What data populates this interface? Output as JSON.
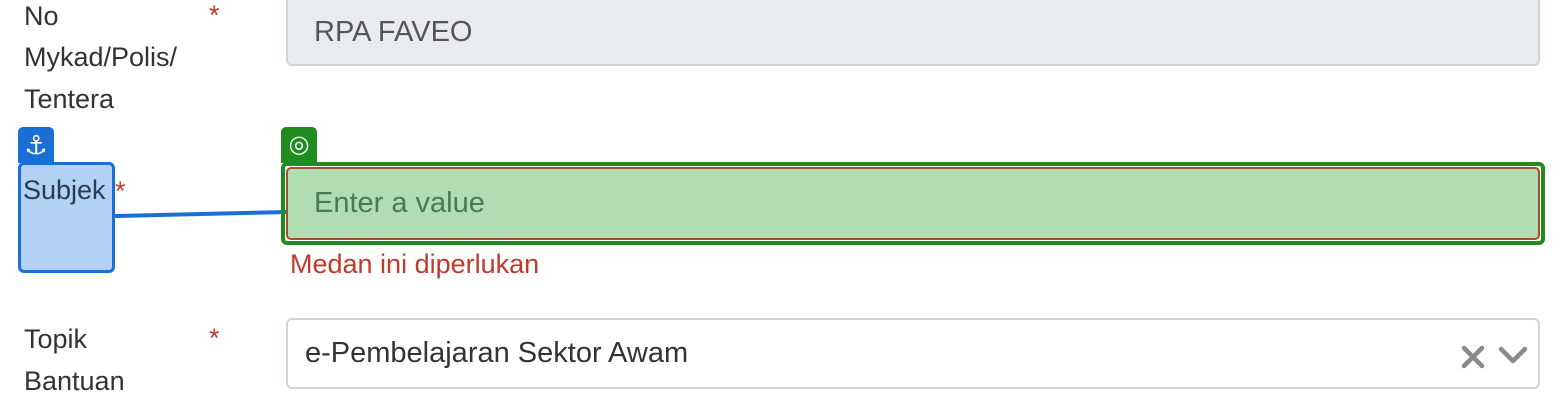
{
  "form": {
    "mykad": {
      "label_line1": "No",
      "label_line2": "Mykad/Polis/",
      "label_line3": "Tentera",
      "required_mark": "*",
      "value": "RPA FAVEO"
    },
    "subjek": {
      "label": "Subjek",
      "required_mark": "*",
      "placeholder": "Enter a value",
      "value": "",
      "error": "Medan ini diperlukan"
    },
    "topik": {
      "label_line1": "Topik",
      "label_line2": "Bantuan",
      "required_mark": "*",
      "selected": "e-Pembelajaran Sektor Awam"
    }
  },
  "overlay": {
    "anchor_icon": "anchor-icon",
    "anchor_glyph": "⚓",
    "anchor_color": "#1a6fd6",
    "target_icon": "target-icon",
    "target_glyph": "◎",
    "target_color": "#1e8c1e"
  },
  "icons": {
    "clear": "clear-x-icon",
    "dropdown": "chevron-down-icon"
  }
}
